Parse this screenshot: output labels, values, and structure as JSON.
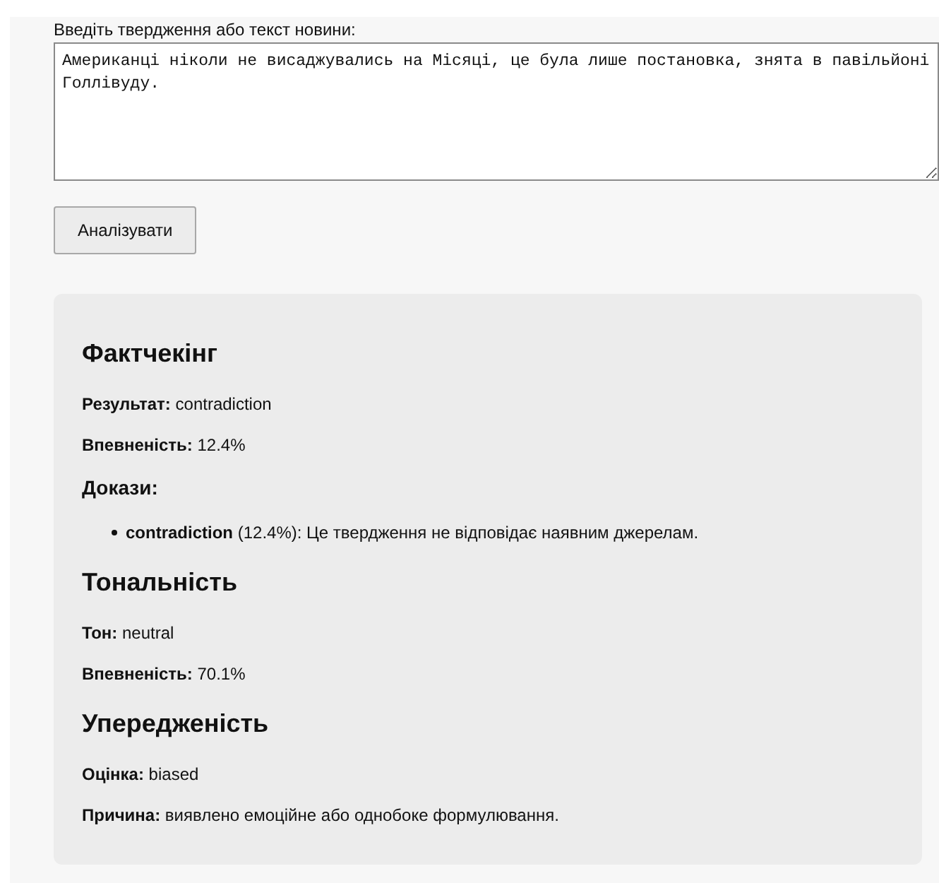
{
  "form": {
    "label": "Введіть твердження або текст новини:",
    "value": "Американці ніколи не висаджувались на Місяці, це була лише постановка, знята в павільйоні Голлівуду.",
    "button": "Аналізувати"
  },
  "sections": [
    {
      "title": "Фактчекінг",
      "items": [
        {
          "kind": "line",
          "text": "**Результат:** contradiction"
        },
        {
          "kind": "line",
          "text": "**Впевненість:** 12.4%"
        },
        {
          "kind": "subheading",
          "text": "**Докази:**"
        },
        {
          "kind": "bullet",
          "text": "**contradiction** (12.4%): Це твердження не відповідає наявним джерелам."
        }
      ]
    },
    {
      "title": "Тональність",
      "items": [
        {
          "kind": "line",
          "text": "**Тон:** neutral"
        },
        {
          "kind": "line",
          "text": "**Впевненість:** 70.1%"
        }
      ]
    },
    {
      "title": "Упередженість",
      "items": [
        {
          "kind": "line",
          "text": "**Оцінка:** biased"
        },
        {
          "kind": "line",
          "text": "**Причина:** виявлено емоційне або однобоке формулювання."
        }
      ]
    }
  ]
}
